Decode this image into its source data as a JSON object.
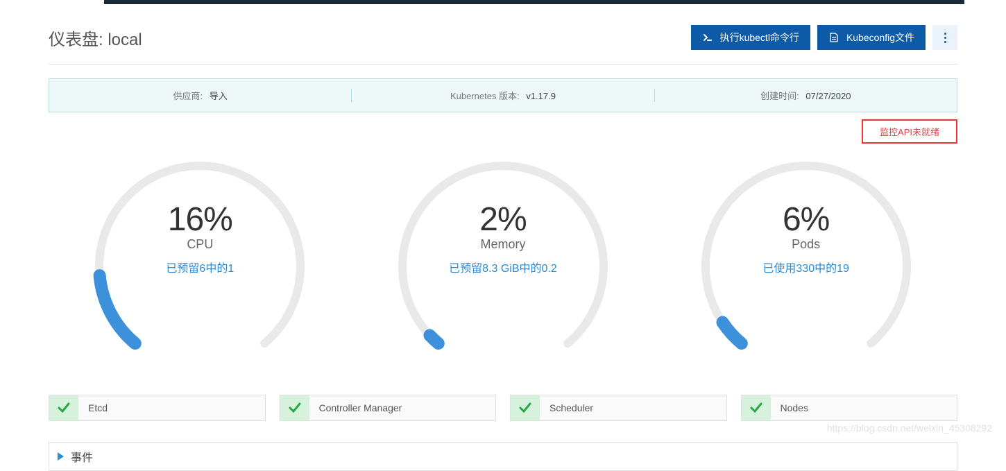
{
  "header": {
    "title": "仪表盘: local",
    "kubectl_btn": "执行kubectl命令行",
    "kubeconfig_btn": "Kubeconfig文件"
  },
  "info": {
    "provider_label": "供应商:",
    "provider_value": "导入",
    "k8s_label": "Kubernetes 版本:",
    "k8s_value": "v1.17.9",
    "created_label": "创建时间:",
    "created_value": "07/27/2020"
  },
  "alert": "监控API未就绪",
  "chart_data": [
    {
      "type": "gauge",
      "percent": 16,
      "display_pct": "16%",
      "label": "CPU",
      "subtitle": "已预留6中的1",
      "portion": 0.16
    },
    {
      "type": "gauge",
      "percent": 2,
      "display_pct": "2%",
      "label": "Memory",
      "subtitle": "已预留8.3 GiB中的0.2",
      "portion": 0.024
    },
    {
      "type": "gauge",
      "percent": 6,
      "display_pct": "6%",
      "label": "Pods",
      "subtitle": "已使用330中的19",
      "portion": 0.058
    }
  ],
  "status": [
    {
      "label": "Etcd"
    },
    {
      "label": "Controller Manager"
    },
    {
      "label": "Scheduler"
    },
    {
      "label": "Nodes"
    }
  ],
  "events": {
    "title": "事件"
  },
  "watermark": "https://blog.csdn.net/weixin_45308292"
}
